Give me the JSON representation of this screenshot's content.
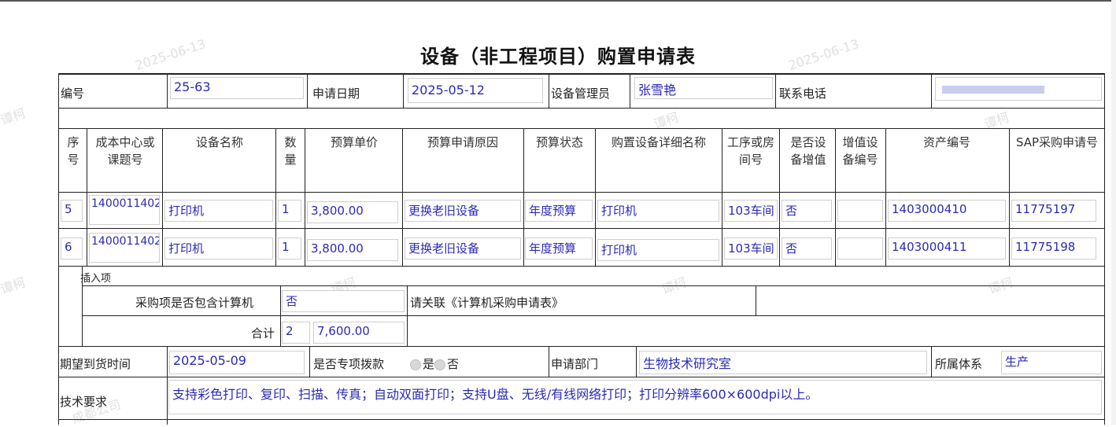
{
  "title": "设备（非工程项目）购置申请表",
  "watermarks": [
    "2025-06-13",
    "谭柯",
    "成都公司"
  ],
  "header": {
    "serial_label": "编号",
    "serial_value": "25-63",
    "apply_date_label": "申请日期",
    "apply_date_value": "2025-05-12",
    "manager_label": "设备管理员",
    "manager_value": "张雪艳",
    "phone_label": "联系电话"
  },
  "table": {
    "columns": [
      "序号",
      "成本中心或课题号",
      "设备名称",
      "数量",
      "预算单价",
      "预算申请原因",
      "预算状态",
      "购置设备详细名称",
      "工序或房间号",
      "是否设备增值",
      "增值设备编号",
      "资产编号",
      "SAP采购申请号"
    ],
    "rows": [
      {
        "seq": "5",
        "cost_center": "1400011402",
        "name": "打印机",
        "qty": "1",
        "price": "3,800.00",
        "reason": "更换老旧设备",
        "status": "年度预算",
        "detail": "打印机",
        "room": "103车间",
        "appreciation": "否",
        "appreciation_no": "",
        "asset_no": "1403000410",
        "sap_no": "11775197"
      },
      {
        "seq": "6",
        "cost_center": "1400011402",
        "name": "打印机",
        "qty": "1",
        "price": "3,800.00",
        "reason": "更换老旧设备",
        "status": "年度预算",
        "detail": "打印机",
        "room": "103车间",
        "appreciation": "否",
        "appreciation_no": "",
        "asset_no": "1403000411",
        "sap_no": "11775198"
      }
    ],
    "insert_label": "插入项"
  },
  "computer": {
    "label": "采购项是否包含计算机",
    "value": "否",
    "link_text": "请关联《计算机采购申请表》"
  },
  "total": {
    "label": "合计",
    "qty": "2",
    "amount": "7,600.00"
  },
  "delivery": {
    "label": "期望到货时间",
    "value": "2025-05-09",
    "special_label": "是否专项拨款",
    "opt_yes": "是",
    "opt_no": "否",
    "dept_label": "申请部门",
    "dept_value": "生物技术研究室",
    "system_label": "所属体系",
    "system_value": "生产"
  },
  "tech": {
    "label": "技术要求",
    "value": "支持彩色打印、复印、扫描、传真；自动双面打印；支持U盘、无线/有线网络打印；打印分辨率600×600dpi以上。"
  }
}
